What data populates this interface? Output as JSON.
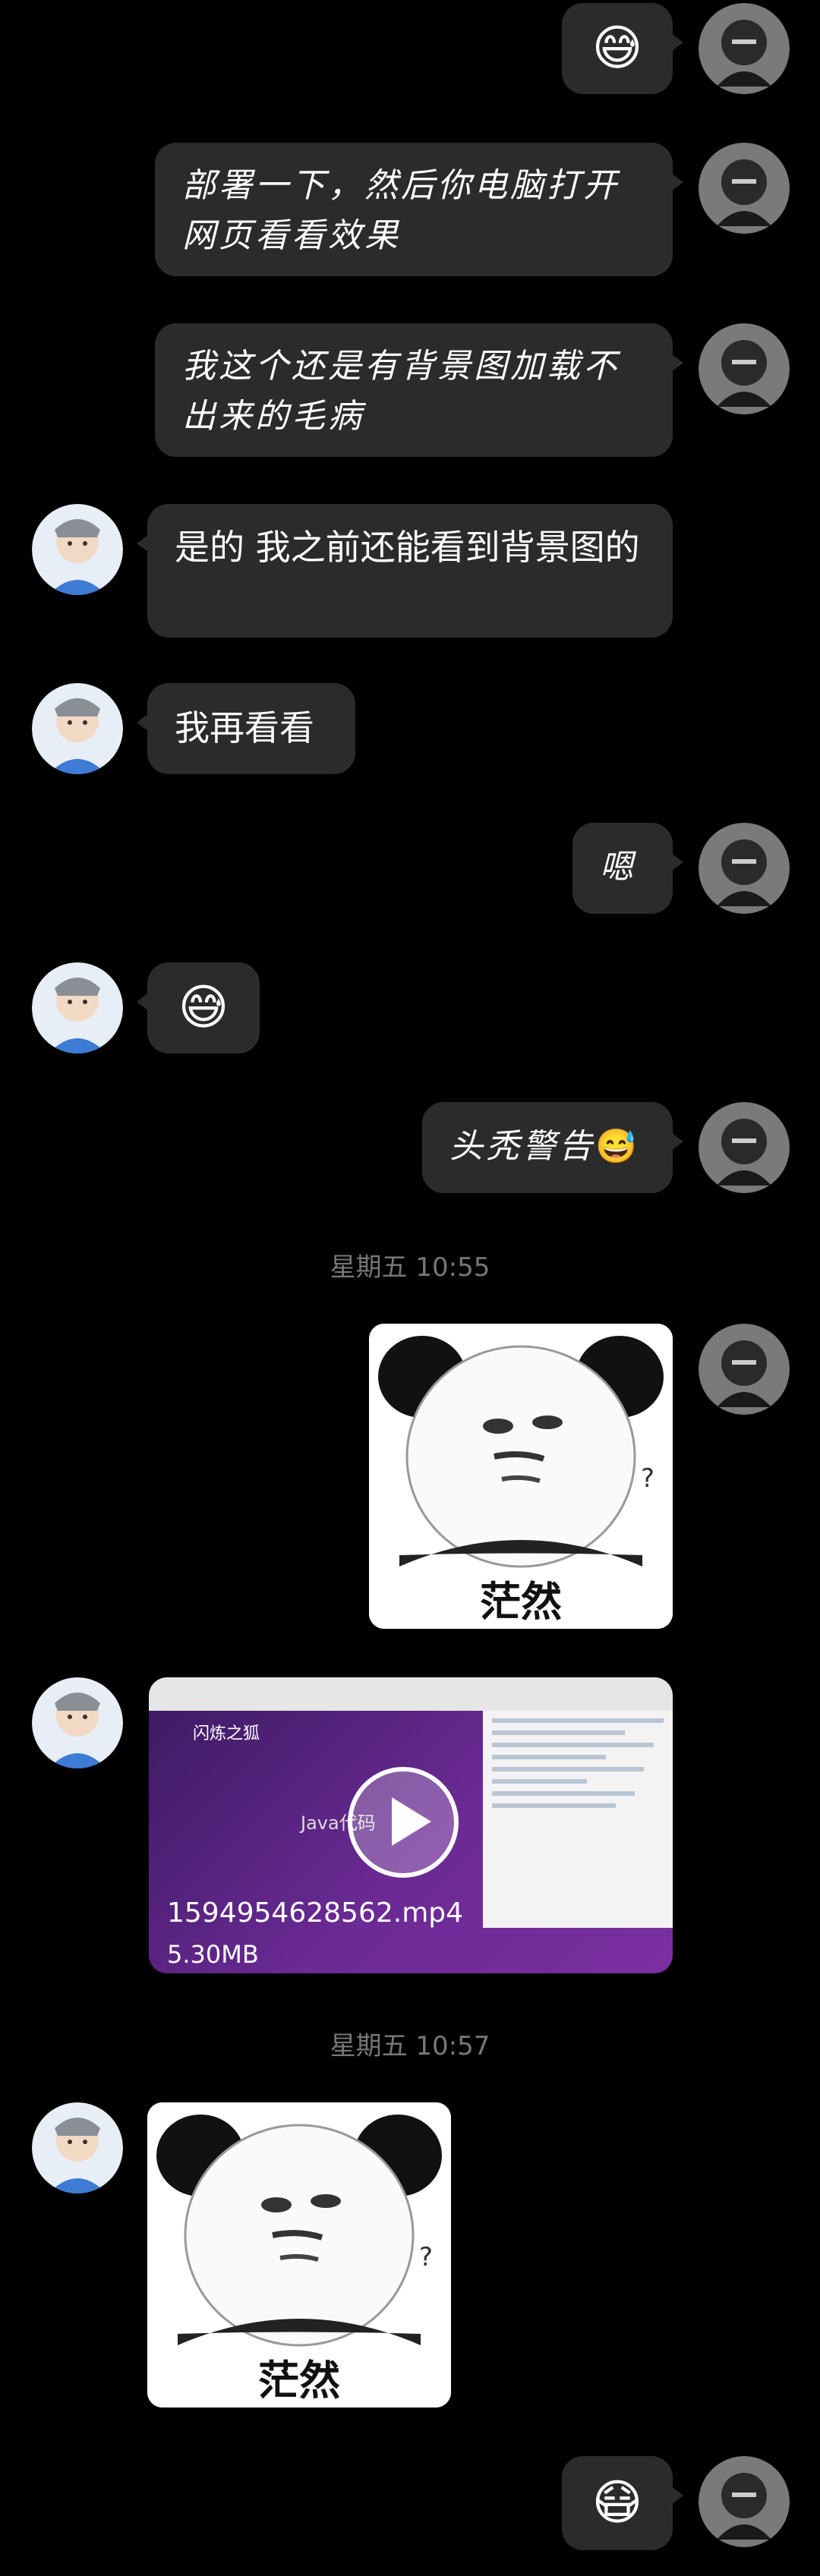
{
  "messages": [
    {
      "side": "right",
      "type": "emoji",
      "emoji": "😅"
    },
    {
      "side": "right",
      "type": "text",
      "text": "部署一下，然后你电脑打开网页看看效果"
    },
    {
      "side": "right",
      "type": "text",
      "text": "我这个还是有背景图加载不出来的毛病"
    },
    {
      "side": "left",
      "type": "text",
      "text": "是的   我之前还能看到背景图的"
    },
    {
      "side": "left",
      "type": "text",
      "text": "我再看看"
    },
    {
      "side": "right",
      "type": "text",
      "text": "嗯"
    },
    {
      "side": "left",
      "type": "emoji",
      "emoji": "😅"
    },
    {
      "side": "right",
      "type": "text",
      "text": "头秃警告",
      "emoji": "😅"
    },
    {
      "side": "right",
      "type": "sticker",
      "caption": "茫然"
    },
    {
      "side": "left",
      "type": "video",
      "filename": "1594954628562.mp4",
      "size": "5.30MB",
      "preview_title": "Java代码",
      "preview_logo": "闪炼之狐"
    },
    {
      "side": "left",
      "type": "sticker",
      "caption": "茫然"
    },
    {
      "side": "right",
      "type": "emoji",
      "emoji": "😷"
    }
  ],
  "timestamps": [
    {
      "label": "星期五 10:55"
    },
    {
      "label": "星期五 10:57"
    }
  ]
}
